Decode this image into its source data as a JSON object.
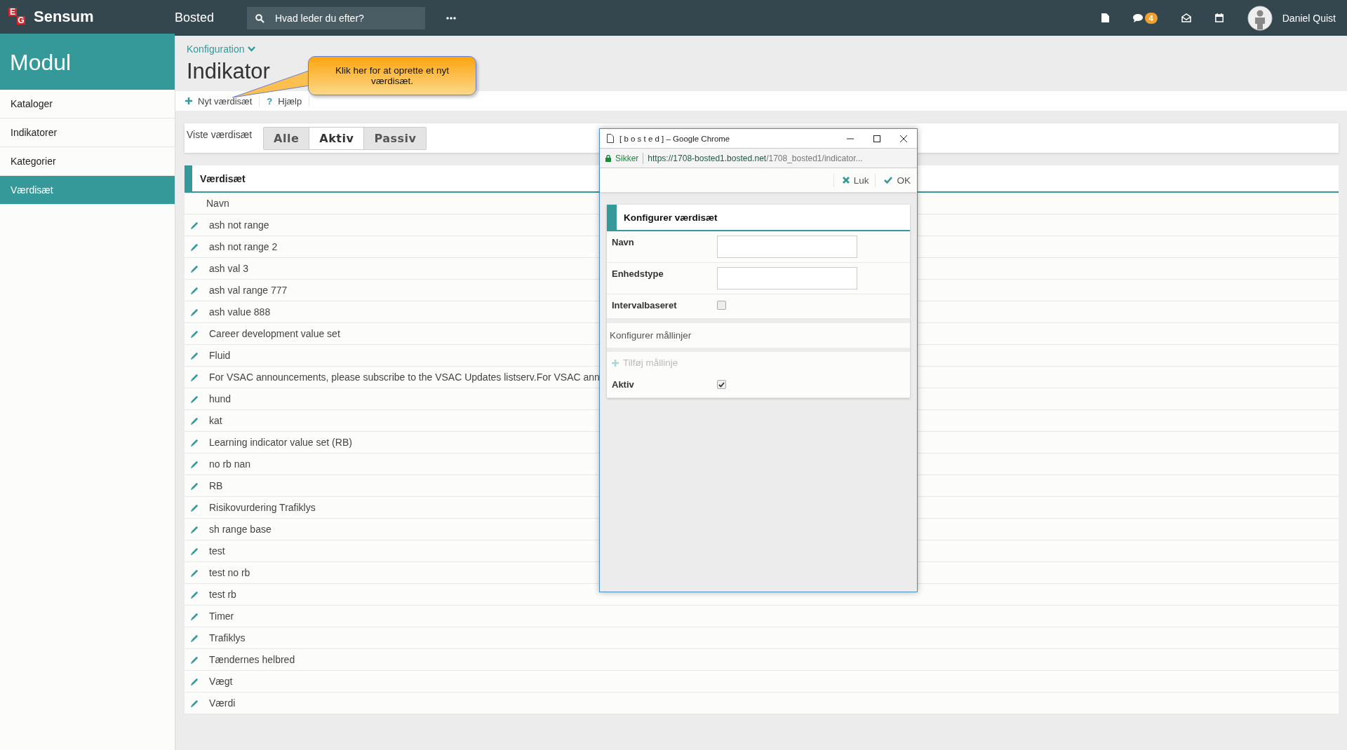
{
  "topbar": {
    "logo_letters": [
      "E",
      "G"
    ],
    "brand": "Sensum",
    "module": "Bosted",
    "search": {
      "placeholder": "Hvad leder du efter?"
    },
    "chat_badge": "4",
    "user_name": "Daniel Quist"
  },
  "sidebar": {
    "title": "Modul",
    "items": [
      {
        "label": "Kataloger",
        "selected": false
      },
      {
        "label": "Indikatorer",
        "selected": false
      },
      {
        "label": "Kategorier",
        "selected": false
      },
      {
        "label": "Værdisæt",
        "selected": true
      }
    ]
  },
  "breadcrumb": "Konfiguration",
  "page_title": "Indikator",
  "toolbar": [
    {
      "kind": "add",
      "label": "Nyt værdisæt"
    },
    {
      "kind": "help",
      "icon": "?",
      "label": "Hjælp"
    }
  ],
  "callout": "Klik her for at oprette et nyt værdisæt.",
  "filter": {
    "label": "Viste værdisæt",
    "options": [
      {
        "label": "Alle",
        "selected": false
      },
      {
        "label": "Aktiv",
        "selected": true
      },
      {
        "label": "Passiv",
        "selected": false
      }
    ]
  },
  "table": {
    "title": "Værdisæt",
    "columns": [
      "Navn"
    ],
    "rows": [
      "ash not range",
      "ash not range 2",
      "ash val 3",
      "ash val range 777",
      "ash value 888",
      "Career development value set",
      "Fluid",
      "For VSAC announcements, please subscribe to the VSAC Updates listserv.For VSAC ann",
      "hund",
      "kat",
      "Learning indicator value set (RB)",
      "no rb nan",
      "RB",
      "Risikovurdering Trafiklys",
      "sh range base",
      "test",
      "test no rb",
      "test rb",
      "Timer",
      "Trafiklys",
      "Tændernes helbred",
      "Vægt",
      "Værdi"
    ]
  },
  "popup": {
    "window_title": "[ b o s t e d ] – Google Chrome",
    "secure": "Sikker",
    "url_host": "https://1708-bosted1.bosted.net",
    "url_path": "/1708_bosted1/indicator...",
    "actions": [
      {
        "kind": "close",
        "label": "Luk"
      },
      {
        "kind": "ok",
        "label": "OK"
      }
    ],
    "form_title": "Konfigurer værdisæt",
    "rows": [
      {
        "kind": "text",
        "label": "Navn"
      },
      {
        "kind": "text",
        "label": "Enhedstype"
      },
      {
        "kind": "checkbox",
        "label": "Intervalbaseret",
        "checked": false
      },
      {
        "kind": "section",
        "label": "Konfigurer mållinjer"
      },
      {
        "kind": "add",
        "label": "Tilføj mållinje",
        "disabled": true
      },
      {
        "kind": "checkbox",
        "label": "Aktiv",
        "checked": true
      }
    ]
  }
}
